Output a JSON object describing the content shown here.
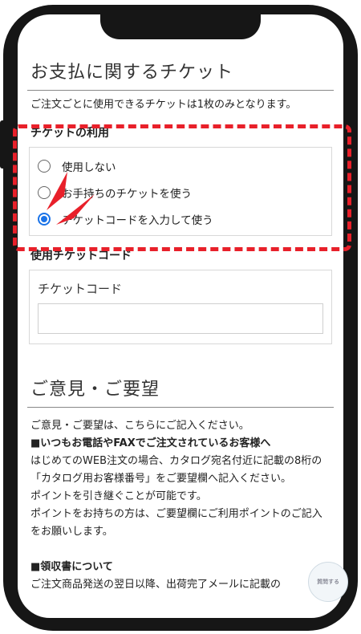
{
  "ticket": {
    "title": "お支払に関するチケット",
    "description": "ご注文ごとに使用できるチケットは1枚のみとなります。",
    "usage_heading": "チケットの利用",
    "options": [
      {
        "label": "使用しない",
        "checked": false
      },
      {
        "label": "お手持ちのチケットを使う",
        "checked": false
      },
      {
        "label": "チケットコードを入力して使う",
        "checked": true
      }
    ],
    "code_heading": "使用チケットコード",
    "code_label": "チケットコード",
    "code_value": ""
  },
  "opinion": {
    "title": "ご意見・ご要望",
    "lines": [
      {
        "text": "ご意見・ご要望は、こちらにご記入ください。",
        "bold": false
      },
      {
        "text": "■いつもお電話やFAXでご注文されているお客様へ",
        "bold": true
      },
      {
        "text": "はじめてのWEB注文の場合、カタログ宛名付近に記載の8桁の「カタログ用お客様番号」をご要望欄へ記入ください。",
        "bold": false
      },
      {
        "text": "ポイントを引き継ぐことが可能です。",
        "bold": false
      },
      {
        "text": "ポイントをお持ちの方は、ご要望欄にご利用ポイントのご記入をお願いします。",
        "bold": false
      }
    ],
    "receipt_heading": "■領収書について",
    "receipt_text": "ご注文商品発送の翌日以降、出荷完了メールに記載の"
  },
  "chat": {
    "label": "質問する"
  },
  "colors": {
    "highlight": "#e8202a",
    "radio_checked": "#1a73e8",
    "frame": "#161616"
  }
}
